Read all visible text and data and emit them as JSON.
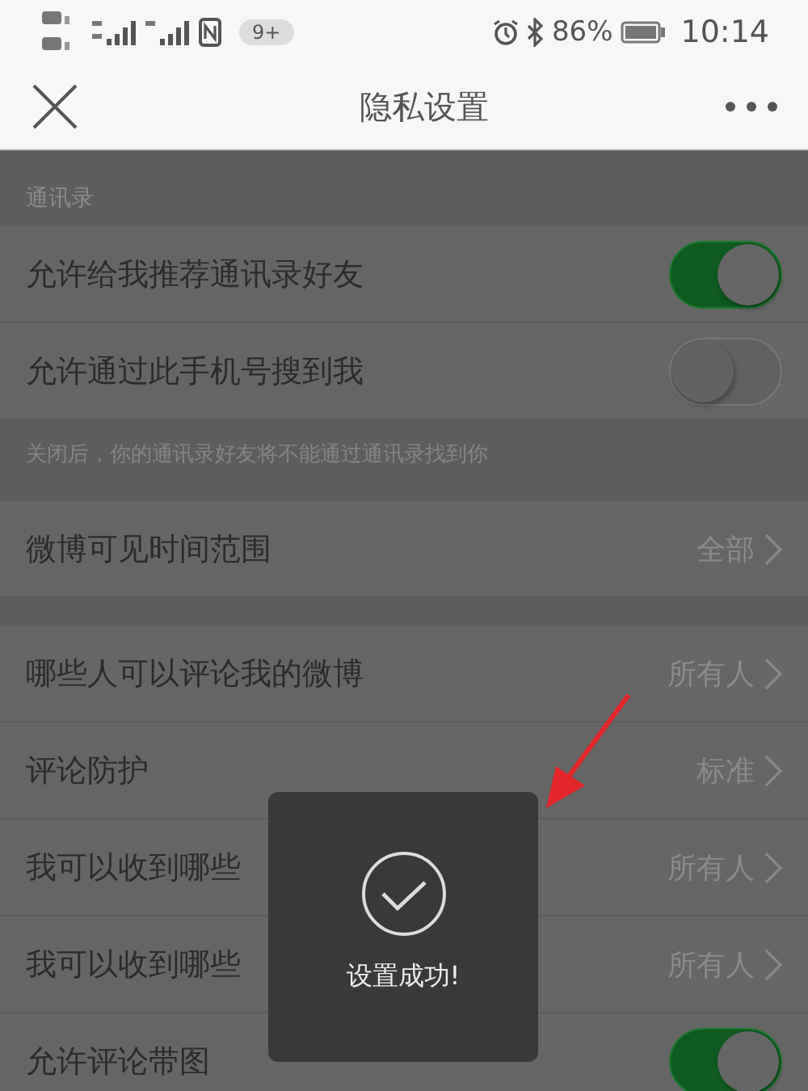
{
  "status_bar": {
    "badge": "9+",
    "battery": "86%",
    "time": "10:14"
  },
  "nav": {
    "title": "隐私设置"
  },
  "sections": [
    {
      "header": "通讯录",
      "items": [
        {
          "kind": "toggle",
          "label": "允许给我推荐通讯录好友",
          "on": true
        },
        {
          "kind": "toggle",
          "label": "允许通过此手机号搜到我",
          "on": false
        }
      ],
      "note": "关闭后，你的通讯录好友将不能通过通讯录找到你"
    },
    {
      "items": [
        {
          "kind": "link",
          "label": "微博可见时间范围",
          "value": "全部"
        }
      ]
    },
    {
      "items": [
        {
          "kind": "link",
          "label": "哪些人可以评论我的微博",
          "value": "所有人"
        },
        {
          "kind": "link",
          "label": "评论防护",
          "value": "标准"
        },
        {
          "kind": "link",
          "label": "我可以收到哪些",
          "value": "所有人"
        },
        {
          "kind": "link",
          "label": "我可以收到哪些",
          "value": "所有人"
        },
        {
          "kind": "toggle",
          "label": "允许评论带图",
          "on": true
        }
      ]
    }
  ],
  "toast": {
    "message": "设置成功!"
  }
}
